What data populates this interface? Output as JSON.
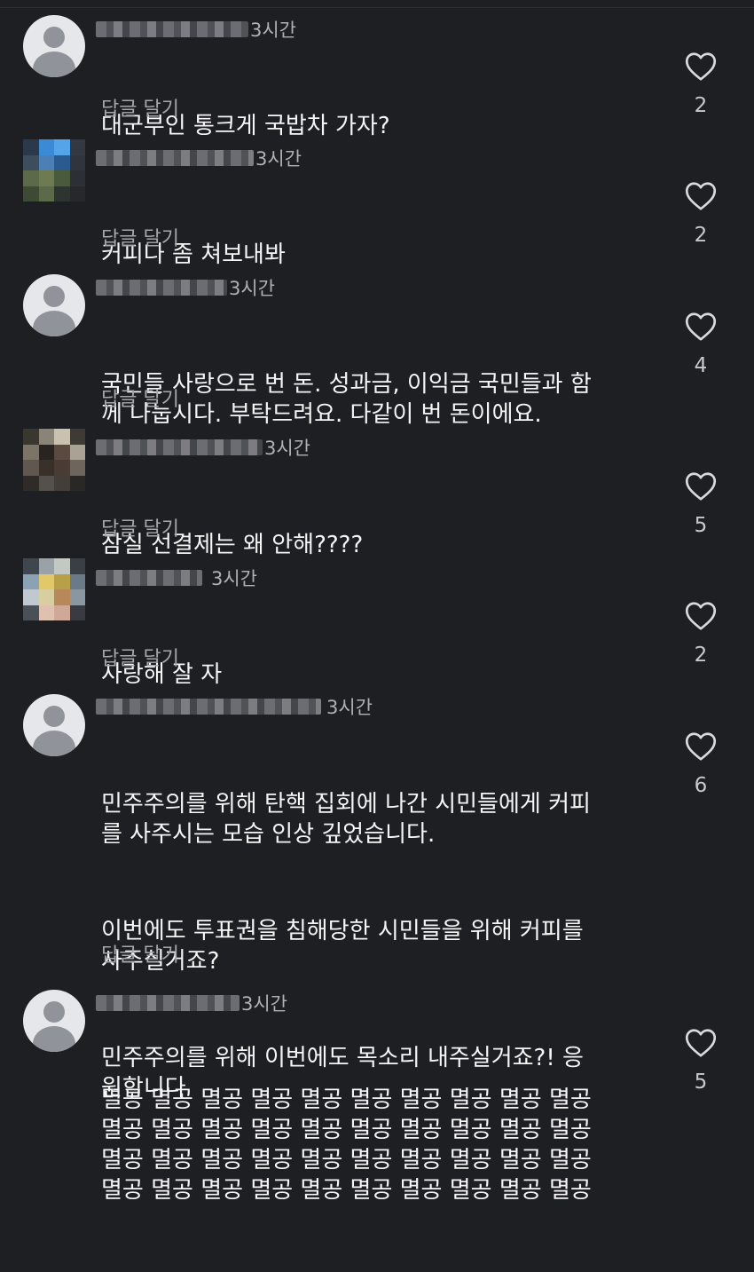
{
  "comments": [
    {
      "time": "3시간",
      "lines": [
        "대군부인 통크게 국밥차 가자?"
      ],
      "reply_label": "답글 달기",
      "likes": "2",
      "avatar": "default"
    },
    {
      "time": "3시간",
      "lines": [
        "커피나 좀 쳐보내봐"
      ],
      "reply_label": "답글 달기",
      "likes": "2",
      "avatar": "pixelated"
    },
    {
      "time": "3시간",
      "lines": [
        "국민들 사랑으로 번 돈. 성과금, 이익금 국민들과 함\n께 나눕시다. 부탁드려요. 다같이 번 돈이에요."
      ],
      "reply_label": "답글 달기",
      "likes": "4",
      "avatar": "default"
    },
    {
      "time": "3시간",
      "lines": [
        "잠실 선결제는 왜 안해????"
      ],
      "reply_label": "답글 달기",
      "likes": "5",
      "avatar": "pixelated"
    },
    {
      "time": "3시간",
      "lines": [
        "사랑해 잘 자"
      ],
      "reply_label": "답글 달기",
      "likes": "2",
      "avatar": "pixelated"
    },
    {
      "time": "3시간",
      "lines": [
        "민주주의를 위해 탄핵 집회에 나간 시민들에게 커피\n를 사주시는 모습 인상 깊었습니다.",
        "이번에도 투표권을 침해당한 시민들을 위해 커피를\n사주실거죠?",
        "민주주의를 위해 이번에도 목소리 내주실거죠?! 응\n원합니다"
      ],
      "reply_label": "답글 달기",
      "likes": "6",
      "avatar": "default"
    },
    {
      "time": "3시간",
      "lines": [
        "멸공 멸공 멸공 멸공 멸공 멸공 멸공 멸공 멸공 멸공\n멸공 멸공 멸공 멸공 멸공 멸공 멸공 멸공 멸공 멸공\n멸공 멸공 멸공 멸공 멸공 멸공 멸공 멸공 멸공 멸공\n멸공 멸공 멸공 멸공 멸공 멸공 멸공 멸공 멸공 멸공"
      ],
      "reply_label": "",
      "likes": "5",
      "avatar": "default"
    }
  ],
  "icons": {
    "like": "heart-outline-icon",
    "default_avatar": "person-icon"
  },
  "colors": {
    "background": "#1e1f23",
    "text": "#f5f5f5",
    "muted": "#a6a7ab"
  }
}
